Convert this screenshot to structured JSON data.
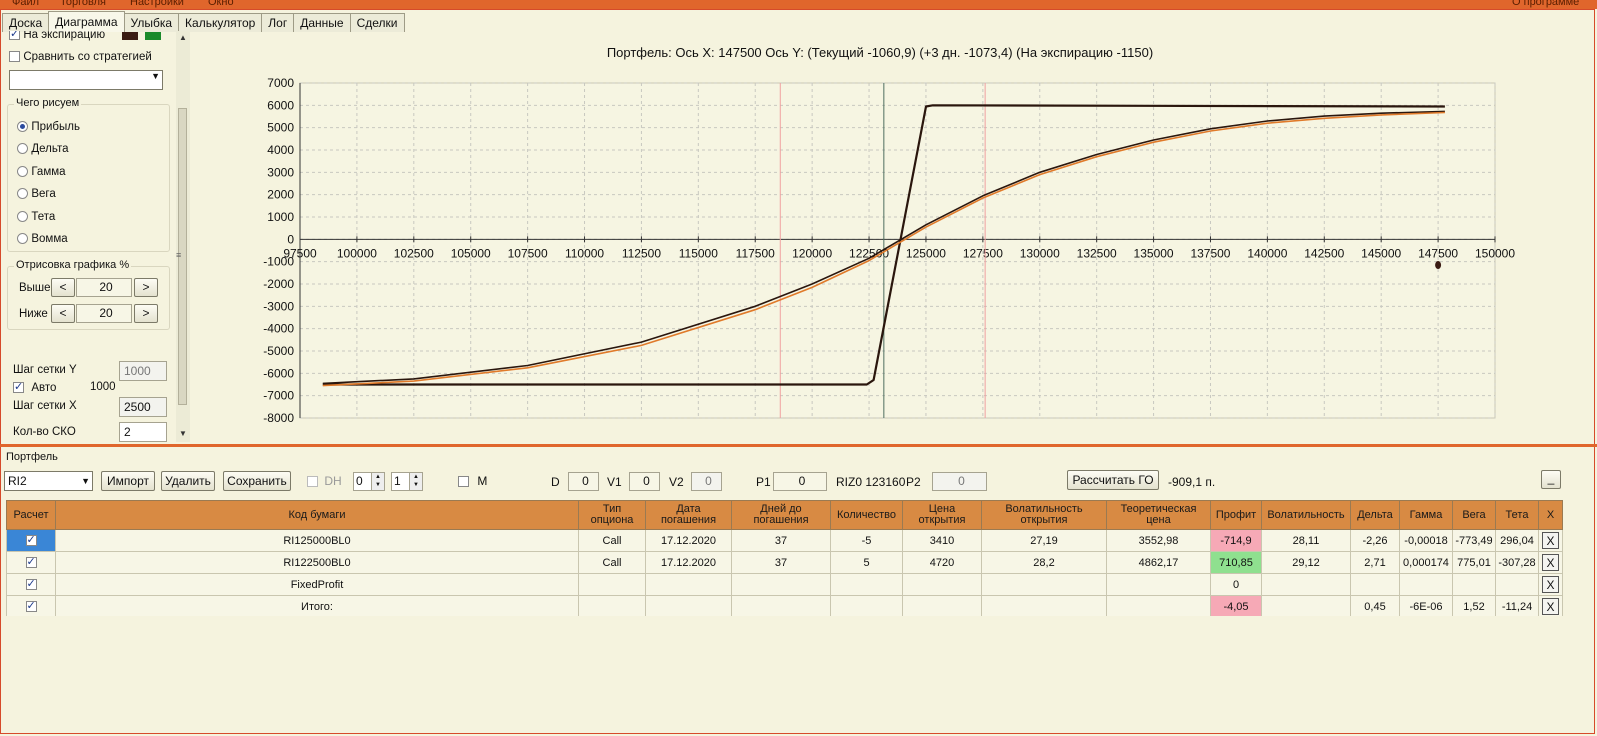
{
  "window": {
    "menu": [
      "Файл",
      "Торговля",
      "Настройки",
      "Окно"
    ],
    "right_text": "О программе"
  },
  "tabs": [
    "Доска",
    "Диаграмма",
    "Улыбка",
    "Калькулятор",
    "Лог",
    "Данные",
    "Сделки"
  ],
  "active_tab": "Диаграмма",
  "left": {
    "expiration_label": "На экспирацию",
    "expiration_checked": true,
    "swatch_colors": [
      "#3a1b12",
      "#1a8a2a"
    ],
    "compare_label": "Сравнить со стратегией",
    "compare_checked": false,
    "strategy_select": "",
    "what_group_title": "Чего рисуем",
    "what_options": [
      "Прибыль",
      "Дельта",
      "Гамма",
      "Вега",
      "Тета",
      "Вомма"
    ],
    "what_selected": "Прибыль",
    "render_group_title": "Отрисовка графика %",
    "above_label": "Выше",
    "above_value": "20",
    "below_label": "Ниже",
    "below_value": "20",
    "dec_label": "<",
    "inc_label": ">",
    "grid_y_label": "Шаг сетки Y",
    "grid_y_value": "1000",
    "auto_label": "Авто",
    "auto_checked": true,
    "auto_value": "1000",
    "grid_x_label": "Шаг сетки X",
    "grid_x_value": "2500",
    "sko_label": "Кол-во СКО",
    "sko_value": "2"
  },
  "chart_title": "Портфель: Ось X: 147500 Ось Y:  (Текущий -1060,9)  (+3 дн. -1073,4)  (На экспирацию -1150)",
  "chart_data": {
    "type": "line",
    "xlim": [
      97500,
      150000
    ],
    "ylim": [
      -8000,
      7000
    ],
    "x_ticks": [
      97500,
      100000,
      102500,
      105000,
      107500,
      110000,
      112500,
      115000,
      117500,
      120000,
      122500,
      125000,
      127500,
      130000,
      132500,
      135000,
      137500,
      140000,
      142500,
      145000,
      147500,
      150000
    ],
    "y_ticks": [
      7000,
      6000,
      5000,
      4000,
      3000,
      2000,
      1000,
      0,
      -1000,
      -2000,
      -3000,
      -4000,
      -5000,
      -6000,
      -7000,
      -8000
    ],
    "grid": true,
    "vertical_lines": [
      {
        "x": 118600,
        "color": "#f0a0a0"
      },
      {
        "x": 123150,
        "color": "#4f6f5f"
      },
      {
        "x": 127600,
        "color": "#f0a0a0"
      }
    ],
    "series": [
      {
        "color": "#2a160d",
        "x": [
          98500,
          122400,
          122700,
          125000,
          125300,
          147800
        ],
        "y": [
          -6500,
          -6500,
          -6300,
          5950,
          6000,
          5950
        ]
      },
      {
        "color": "#2a160d",
        "x": [
          98500,
          102500,
          107500,
          112500,
          117500,
          120000,
          122500,
          125000,
          127500,
          130000,
          132500,
          135000,
          137500,
          140000,
          142500,
          145000,
          147800
        ],
        "y": [
          -6450,
          -6250,
          -5650,
          -4600,
          -3000,
          -2000,
          -850,
          650,
          1950,
          3000,
          3800,
          4450,
          4950,
          5300,
          5520,
          5650,
          5730
        ]
      },
      {
        "color": "#e07a2a",
        "x": [
          98500,
          102500,
          107500,
          112500,
          117500,
          120000,
          122500,
          125000,
          127500,
          130000,
          132500,
          135000,
          137500,
          140000,
          142500,
          145000,
          147800
        ],
        "y": [
          -6550,
          -6350,
          -5750,
          -4750,
          -3150,
          -2150,
          -950,
          550,
          1850,
          2900,
          3700,
          4350,
          4850,
          5200,
          5420,
          5570,
          5680
        ]
      }
    ],
    "marker": {
      "x": 147500,
      "y": -1150
    }
  },
  "portfolio": {
    "title": "Портфель",
    "account": "RI2",
    "import_label": "Импорт",
    "delete_label": "Удалить",
    "save_label": "Сохранить",
    "dh_label": "DH",
    "spin1": "0",
    "spin2": "1",
    "m_label": "M",
    "d_label": "D",
    "d_value": "0",
    "v1_label": "V1",
    "v1_value": "0",
    "v2_label": "V2",
    "v2_value": "0",
    "p1_label": "P1",
    "p1_value": "0",
    "riz_text": "RIZ0 123160",
    "p2_label": "P2",
    "p2_value": "0",
    "calc_label": "Рассчитать ГО",
    "go_value": "-909,1 п.",
    "minimize_label": "_"
  },
  "table": {
    "headers": [
      "Расчет",
      "Код бумаги",
      "Тип опциона",
      "Дата погашения",
      "Дней до погашения",
      "Количество",
      "Цена открытия",
      "Волатильность открытия",
      "Теоретическая цена",
      "Профит",
      "Волатильность",
      "Дельта",
      "Гамма",
      "Вега",
      "Тета",
      "X"
    ],
    "rows": [
      {
        "calc": true,
        "code": "RI125000BL0",
        "type": "Call",
        "date": "17.12.2020",
        "days": "37",
        "qty": "-5",
        "open": "3410",
        "vol_open": "27,19",
        "theo": "3552,98",
        "profit": "-714,9",
        "profit_sign": "neg",
        "vol": "28,11",
        "delta": "-2,26",
        "gamma": "-0,00018",
        "vega": "-773,49",
        "theta": "296,04",
        "x": "X"
      },
      {
        "calc": true,
        "code": "RI122500BL0",
        "type": "Call",
        "date": "17.12.2020",
        "days": "37",
        "qty": "5",
        "open": "4720",
        "vol_open": "28,2",
        "theo": "4862,17",
        "profit": "710,85",
        "profit_sign": "pos",
        "vol": "29,12",
        "delta": "2,71",
        "gamma": "0,000174",
        "vega": "775,01",
        "theta": "-307,28",
        "x": "X"
      },
      {
        "calc": true,
        "code": "FixedProfit",
        "type": "",
        "date": "",
        "days": "",
        "qty": "",
        "open": "",
        "vol_open": "",
        "theo": "",
        "profit": "0",
        "profit_sign": "",
        "vol": "",
        "delta": "",
        "gamma": "",
        "vega": "",
        "theta": "",
        "x": "X"
      },
      {
        "calc": true,
        "code": "Итого:",
        "type": "",
        "date": "",
        "days": "",
        "qty": "",
        "open": "",
        "vol_open": "",
        "theo": "",
        "profit": "-4,05",
        "profit_sign": "neg",
        "vol": "",
        "delta": "0,45",
        "gamma": "-6E-06",
        "vega": "1,52",
        "theta": "-11,24",
        "x": "X"
      }
    ]
  }
}
